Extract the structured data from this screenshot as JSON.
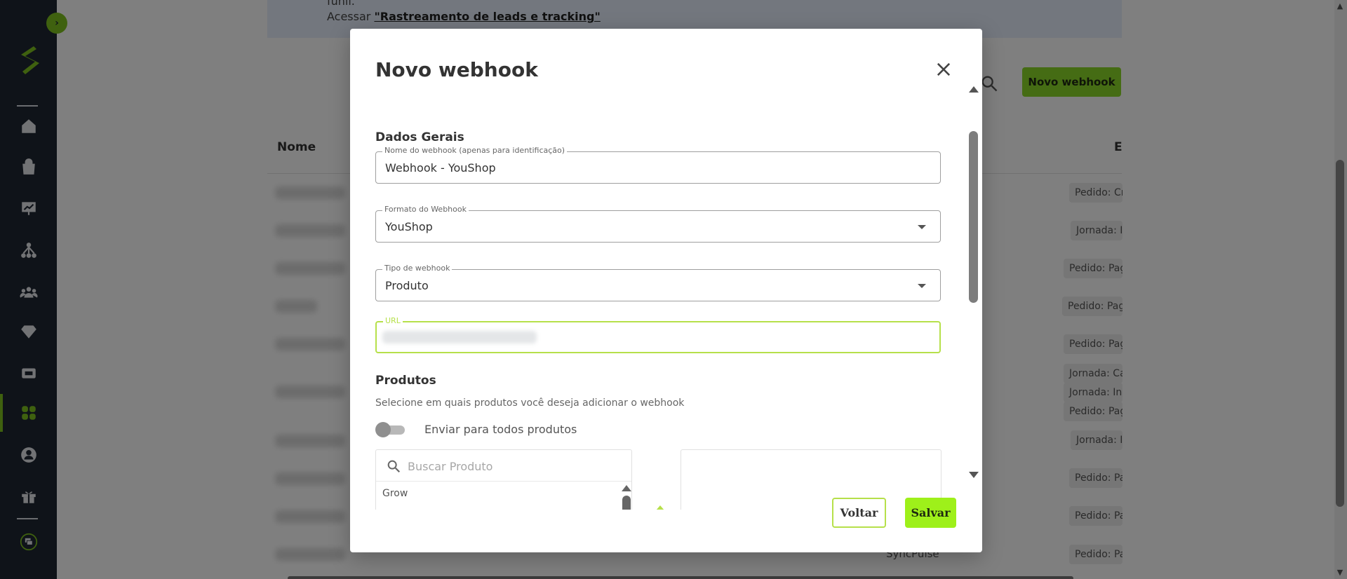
{
  "background": {
    "banner": {
      "line1": "funil.",
      "line2_prefix": "Acessar ",
      "line2_link": "\"Rastreamento de leads e tracking\""
    },
    "new_webhook_button": "Novo webhook",
    "table_headers": {
      "name": "Nome",
      "events": "E"
    },
    "rows": [
      {
        "tags": [
          "Pedido: Cr"
        ]
      },
      {
        "tags": [
          "Jornada: Ir"
        ]
      },
      {
        "tags": [
          "Pedido: Pag"
        ]
      },
      {
        "tags": [
          "Pedido: Pag"
        ]
      },
      {
        "tags": [
          "Pedido: Pag"
        ]
      },
      {
        "tags": [
          "Jornada: Ca",
          "Jornada: Ini",
          "Pedido: Pag"
        ]
      },
      {
        "tags": [
          "Jornada: Ir"
        ]
      },
      {
        "tags": [
          "Pedido: Pa"
        ]
      },
      {
        "tags": [
          "Pedido: Pa"
        ]
      },
      {
        "tags": [
          "Pedido: Pa"
        ]
      }
    ],
    "last_row_integration": "SyncPulse"
  },
  "modal": {
    "title": "Novo webhook",
    "section_general": "Dados Gerais",
    "fields": {
      "name": {
        "label": "Nome do webhook (apenas para identificação)",
        "value": "Webhook - YouShop"
      },
      "format": {
        "label": "Formato do Webhook",
        "value": "YouShop"
      },
      "type": {
        "label": "Tipo de webhook",
        "value": "Produto"
      },
      "url": {
        "label": "URL",
        "value": ""
      }
    },
    "section_products": "Produtos",
    "products_helper": "Selecione em quais produtos você deseja adicionar o webhook",
    "toggle_all_label": "Enviar para todos produtos",
    "product_search_placeholder": "Buscar Produto",
    "product_list": [
      "Grow"
    ],
    "buttons": {
      "back": "Voltar",
      "save": "Salvar"
    }
  },
  "colors": {
    "accent_green": "#9ef01a",
    "sidebar_bg": "#1f2733",
    "focus_border": "#b6e04a"
  },
  "icons": [
    "chevron-right-icon",
    "logo-icon",
    "home-icon",
    "bag-icon",
    "presentation-icon",
    "network-icon",
    "users-icon",
    "diamond-icon",
    "ticket-icon",
    "apps-icon",
    "user-circle-icon",
    "gift-icon",
    "chat-icon",
    "search-icon",
    "close-icon",
    "chevron-down-icon"
  ]
}
